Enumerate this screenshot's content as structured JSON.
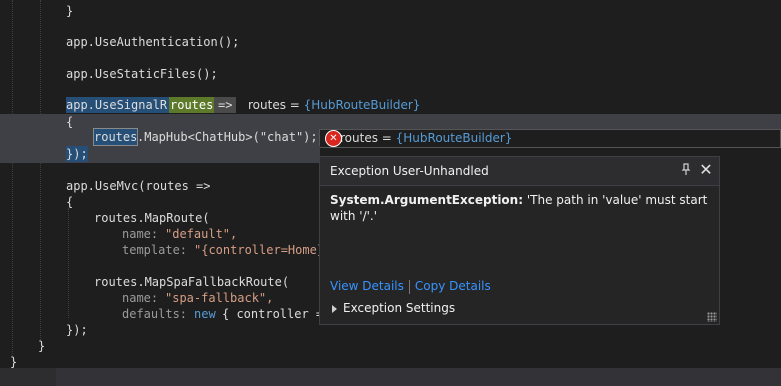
{
  "code": {
    "lines": [
      "}",
      "app.UseAuthentication();",
      "app.UseStaticFiles();",
      "app.UseSignalR(",
      "routes",
      "=>",
      "{",
      "routes",
      ".MapHub<ChatHub>(\"chat\");",
      "});",
      "app.UseMvc(routes =>",
      "{",
      "routes.MapRoute(",
      "name:",
      "\"default\",",
      "template:",
      "\"{controller=Home}",
      "routes.MapSpaFallbackRoute(",
      "name:",
      "\"spa-fallback\",",
      "defaults:",
      "new",
      "{ controller =",
      "});",
      "}",
      "}"
    ]
  },
  "datatips": [
    {
      "name": "routes = ",
      "type": "{HubRouteBuilder}"
    },
    {
      "name": "routes = ",
      "type": "{HubRouteBuilder}"
    }
  ],
  "exception_popup": {
    "title": "Exception User-Unhandled",
    "exception_type": "System.ArgumentException:",
    "message": "'The path in 'value' must start with '/'.'",
    "view_details": "View Details",
    "copy_details": "Copy Details",
    "settings": "Exception Settings"
  },
  "icons": {
    "error": "error-circle-icon",
    "pin": "pin-icon",
    "close": "close-icon"
  },
  "colors": {
    "keyword": "#569cd6",
    "string": "#d69d85",
    "link": "#3794ff",
    "error": "#d9251d"
  }
}
